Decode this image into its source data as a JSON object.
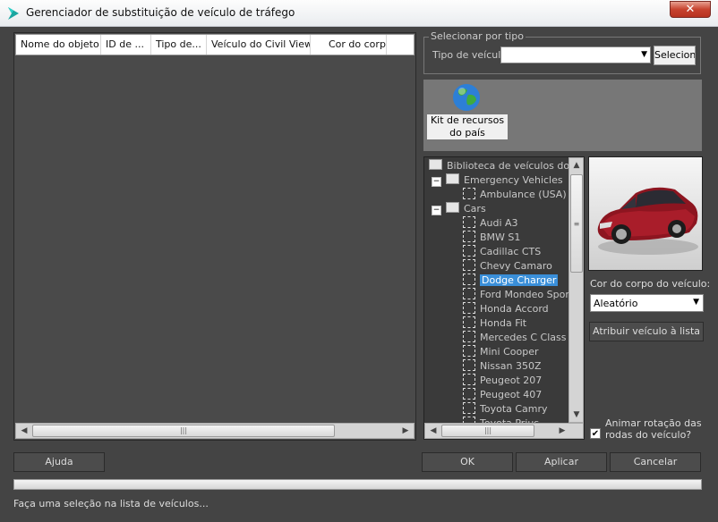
{
  "window": {
    "title": "Gerenciador de substituição de veículo de tráfego",
    "close": "✕"
  },
  "list": {
    "columns": [
      "Nome do objeto",
      "ID de ...",
      "Tipo de...",
      "Veículo do Civil View",
      "Cor do corpo"
    ]
  },
  "select_by_type": {
    "group_label": "Selecionar por tipo",
    "type_label": "Tipo de veículo:",
    "type_value": "",
    "select_button": "Selecionar"
  },
  "kit": {
    "label": "Kit de recursos do país"
  },
  "tree": {
    "root": "Biblioteca de veículos do Civil View",
    "groups": [
      {
        "name": "Emergency Vehicles",
        "items": [
          "Ambulance (USA)"
        ]
      },
      {
        "name": "Cars",
        "items": [
          "Audi A3",
          "BMW S1",
          "Cadillac CTS",
          "Chevy Camaro",
          "Dodge Charger",
          "Ford Mondeo Sportbreak",
          "Honda Accord",
          "Honda Fit",
          "Mercedes C Class",
          "Mini Cooper",
          "Nissan 350Z",
          "Peugeot 207",
          "Peugeot 407",
          "Toyota Camry",
          "Toyota Prius"
        ]
      }
    ],
    "selected": "Dodge Charger"
  },
  "body_color": {
    "label": "Cor do corpo do veículo:",
    "value": "Aleatório"
  },
  "assign_button": "Atribuir veículo à lista",
  "animate": {
    "label": "Animar rotação das rodas do veículo?",
    "checked": true,
    "check": "✔"
  },
  "buttons": {
    "help": "Ajuda",
    "ok": "OK",
    "apply": "Aplicar",
    "cancel": "Cancelar"
  },
  "status": "Faça uma seleção na lista de veículos..."
}
